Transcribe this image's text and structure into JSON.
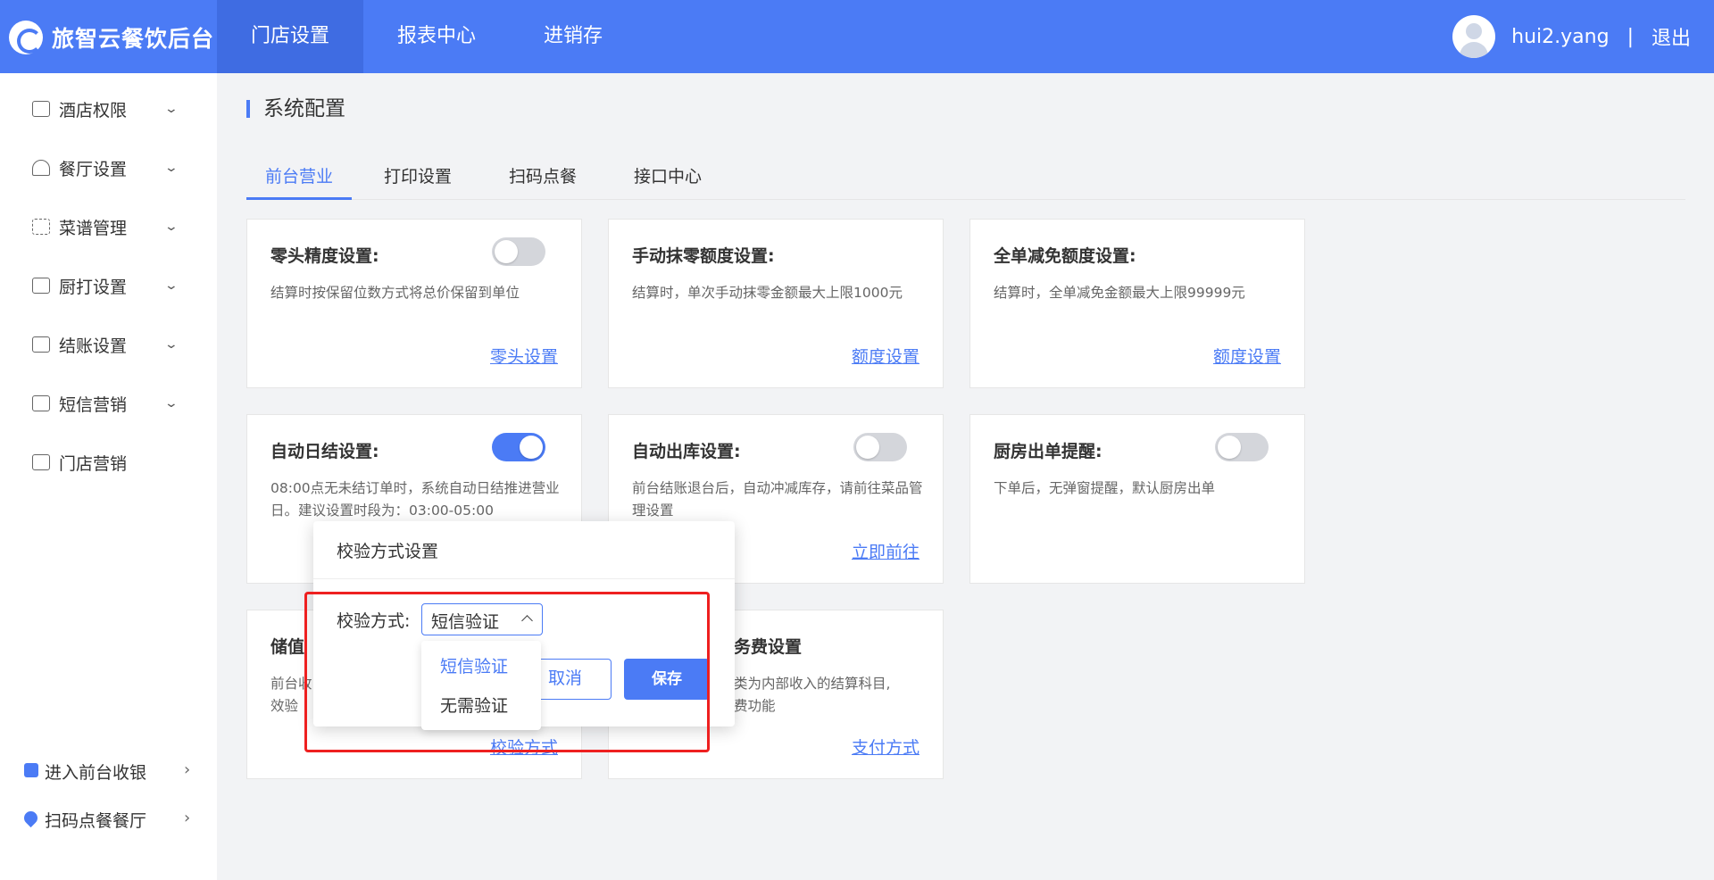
{
  "header": {
    "logo_text": "旅智云餐饮后台",
    "nav": [
      "门店设置",
      "报表中心",
      "进销存"
    ],
    "username": "hui2.yang",
    "separator": "|",
    "logout": "退出"
  },
  "sidebar": {
    "items": [
      {
        "label": "酒店权限",
        "icon": "hotel-icon"
      },
      {
        "label": "餐厅设置",
        "icon": "dish-cover-icon"
      },
      {
        "label": "菜谱管理",
        "icon": "grid-icon"
      },
      {
        "label": "厨打设置",
        "icon": "printer-icon"
      },
      {
        "label": "结账设置",
        "icon": "receipt-icon"
      },
      {
        "label": "短信营销",
        "icon": "mail-icon"
      },
      {
        "label": "门店营销",
        "icon": "store-icon"
      }
    ],
    "bottom": [
      {
        "label": "进入前台收银",
        "icon": "monitor-icon"
      },
      {
        "label": "扫码点餐餐厅",
        "icon": "location-pin-icon"
      }
    ]
  },
  "page": {
    "title": "系统配置",
    "tabs": [
      "前台营业",
      "打印设置",
      "扫码点餐",
      "接口中心"
    ]
  },
  "cards": [
    {
      "title": "零头精度设置:",
      "desc": "结算时按保留位数方式将总价保留到单位",
      "link": "零头设置",
      "toggle": "off"
    },
    {
      "title": "手动抹零额度设置:",
      "desc": "结算时，单次手动抹零金额最大上限1000元",
      "link": "额度设置"
    },
    {
      "title": "全单减免额度设置:",
      "desc": "结算时，全单减免金额最大上限99999元",
      "link": "额度设置"
    },
    {
      "title": "自动日结设置:",
      "desc": "08:00点无未结订单时，系统自动日结推进营业日。建议设置时段为：03:00-05:00",
      "toggle": "on"
    },
    {
      "title": "自动出库设置:",
      "desc": "前台结账退台后，自动冲减库存，请前往菜品管理设置",
      "link": "立即前往",
      "toggle": "off"
    },
    {
      "title": "厨房出单提醒:",
      "desc": "下单后，无弹窗提醒，默认厨房出单",
      "toggle": "off"
    },
    {
      "title": "储值",
      "desc_line1": "前台收",
      "desc_line2": "效验",
      "link": "校验方式"
    },
    {
      "title": "务费设置",
      "desc_line1": "类为内部收入的结算科目,",
      "desc_line2": "费功能",
      "link": "支付方式"
    }
  ],
  "modal": {
    "title": "校验方式设置",
    "label": "校验方式:",
    "selected": "短信验证",
    "options": [
      "短信验证",
      "无需验证"
    ],
    "cancel": "取消",
    "save": "保存"
  },
  "colors": {
    "primary": "#4b7bf5",
    "header_active": "#3f6ce2",
    "highlight": "#ee2020"
  }
}
